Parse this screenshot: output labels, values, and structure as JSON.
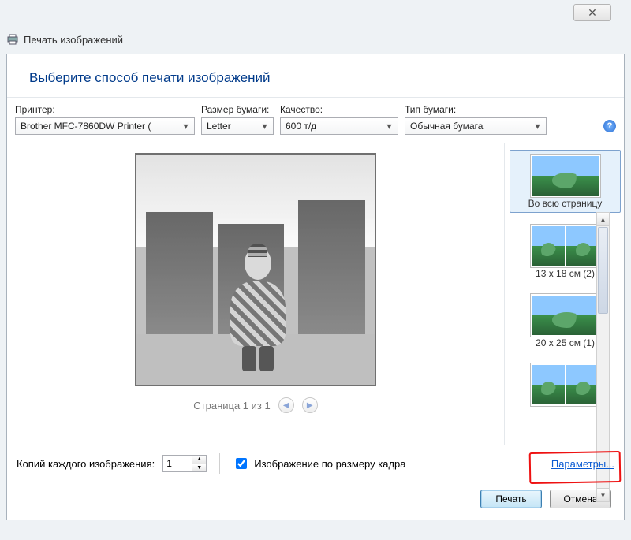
{
  "titlebar": {
    "title": "Печать изображений"
  },
  "header": {
    "instruction": "Выберите способ печати изображений"
  },
  "controls": {
    "printer": {
      "label": "Принтер:",
      "value": "Brother MFC-7860DW Printer ("
    },
    "paper_size": {
      "label": "Размер бумаги:",
      "value": "Letter"
    },
    "quality": {
      "label": "Качество:",
      "value": "600 т/д"
    },
    "paper_type": {
      "label": "Тип бумаги:",
      "value": "Обычная бумага"
    }
  },
  "preview": {
    "pager_text": "Страница 1 из 1"
  },
  "layouts": [
    {
      "label": "Во всю страницу",
      "thumbs": 1,
      "selected": true
    },
    {
      "label": "13 x 18 см (2)",
      "thumbs": 2,
      "selected": false
    },
    {
      "label": "20 x 25 см (1)",
      "thumbs": 1,
      "selected": false
    },
    {
      "label": "",
      "thumbs": 2,
      "selected": false
    }
  ],
  "bottom": {
    "copies_label": "Копий каждого изображения:",
    "copies_value": "1",
    "fit_label": "Изображение по размеру кадра",
    "fit_checked": true,
    "options_link": "Параметры..."
  },
  "actions": {
    "print": "Печать",
    "cancel": "Отмена"
  }
}
